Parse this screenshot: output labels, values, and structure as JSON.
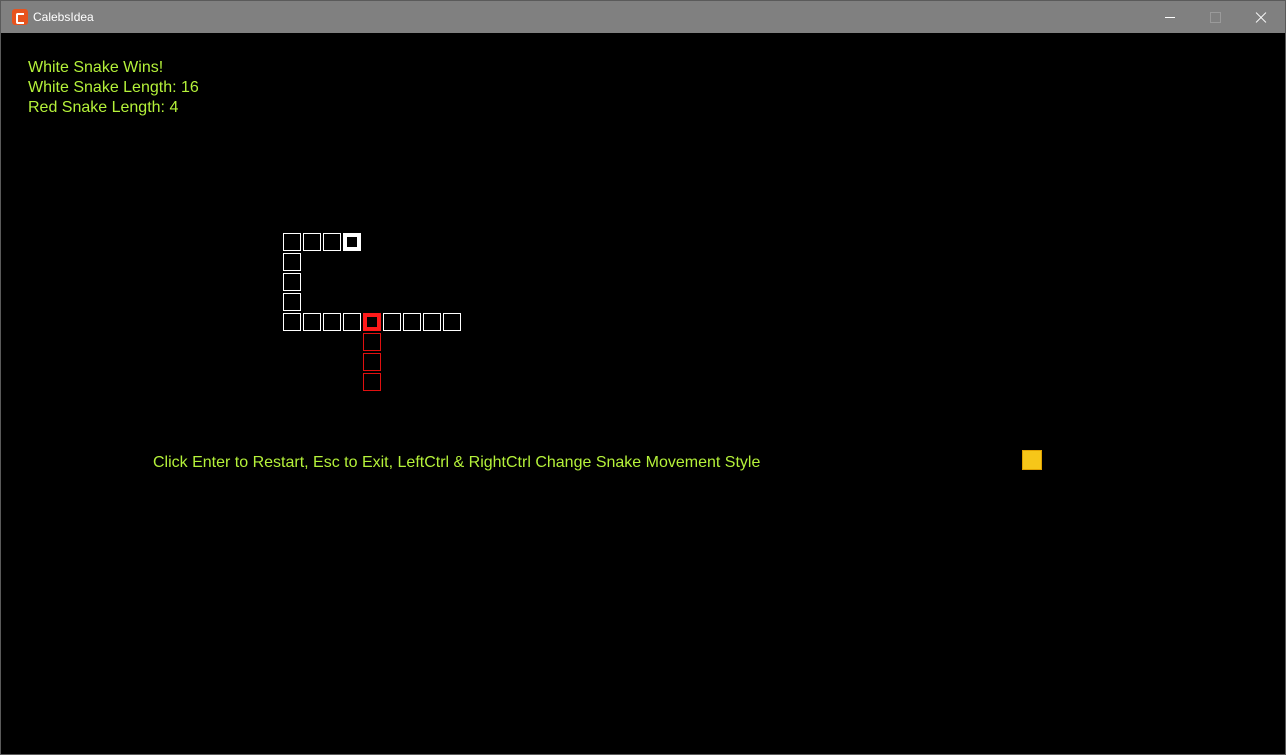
{
  "window": {
    "title": "CalebsIdea"
  },
  "hud": {
    "winner": "White Snake Wins!",
    "white_length": "White Snake Length: 16",
    "red_length": "Red Snake Length: 4",
    "instructions": "Click Enter to Restart, Esc to Exit, LeftCtrl & RightCtrl Change Snake Movement Style"
  },
  "colors": {
    "hud_text": "#b5f23a",
    "white_snake": "#ffffff",
    "red_snake": "#e01010",
    "food_fill": "#f7c619",
    "food_border": "#e0a000",
    "background": "#000000",
    "titlebar": "#808080"
  },
  "board": {
    "white_snake": {
      "length": 16,
      "cells": [
        [
          3,
          0
        ],
        [
          2,
          0
        ],
        [
          1,
          0
        ],
        [
          0,
          0
        ],
        [
          0,
          1
        ],
        [
          0,
          2
        ],
        [
          0,
          3
        ],
        [
          0,
          4
        ],
        [
          1,
          4
        ],
        [
          2,
          4
        ],
        [
          3,
          4
        ],
        [
          4,
          4
        ],
        [
          5,
          4
        ],
        [
          6,
          4
        ],
        [
          7,
          4
        ],
        [
          8,
          4
        ]
      ]
    },
    "red_snake": {
      "length": 4,
      "cells": [
        [
          4,
          4
        ],
        [
          4,
          5
        ],
        [
          4,
          6
        ],
        [
          4,
          7
        ]
      ]
    },
    "food": [
      37,
      11
    ]
  }
}
